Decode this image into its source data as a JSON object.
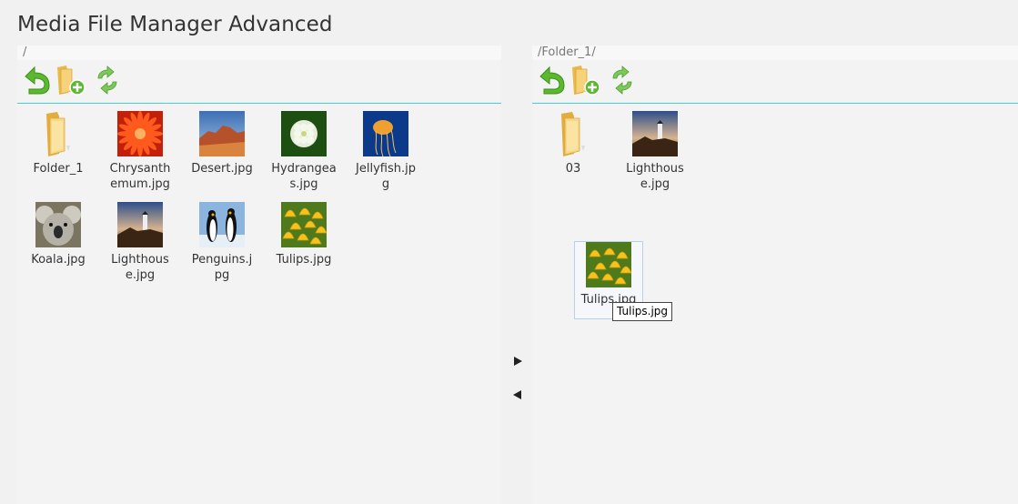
{
  "app": {
    "title": "Media File Manager Advanced"
  },
  "left_pane": {
    "path": "/",
    "items": [
      {
        "name": "Folder_1",
        "type": "folder"
      },
      {
        "name": "Chrysanthemum.jpg",
        "type": "image",
        "thumb": "chrysanthemum"
      },
      {
        "name": "Desert.jpg",
        "type": "image",
        "thumb": "desert"
      },
      {
        "name": "Hydrangeas.jpg",
        "type": "image",
        "thumb": "hydrangeas"
      },
      {
        "name": "Jellyfish.jpg",
        "type": "image",
        "thumb": "jellyfish"
      },
      {
        "name": "Koala.jpg",
        "type": "image",
        "thumb": "koala"
      },
      {
        "name": "Lighthouse.jpg",
        "type": "image",
        "thumb": "lighthouse"
      },
      {
        "name": "Penguins.jpg",
        "type": "image",
        "thumb": "penguins"
      },
      {
        "name": "Tulips.jpg",
        "type": "image",
        "thumb": "tulips"
      }
    ]
  },
  "right_pane": {
    "path": "/Folder_1/",
    "items": [
      {
        "name": "03",
        "type": "folder"
      },
      {
        "name": "Lighthouse.jpg",
        "type": "image",
        "thumb": "lighthouse"
      }
    ]
  },
  "drag_item": {
    "name": "Tulips.jpg",
    "tooltip": "Tulips.jpg"
  },
  "toolbar_icons": [
    "back-arrow-icon",
    "new-folder-icon",
    "refresh-icon"
  ],
  "colors": {
    "divider": "#3fd0d8",
    "icon_green": "#5cb82e",
    "folder_yellow": "#f0c45a"
  }
}
